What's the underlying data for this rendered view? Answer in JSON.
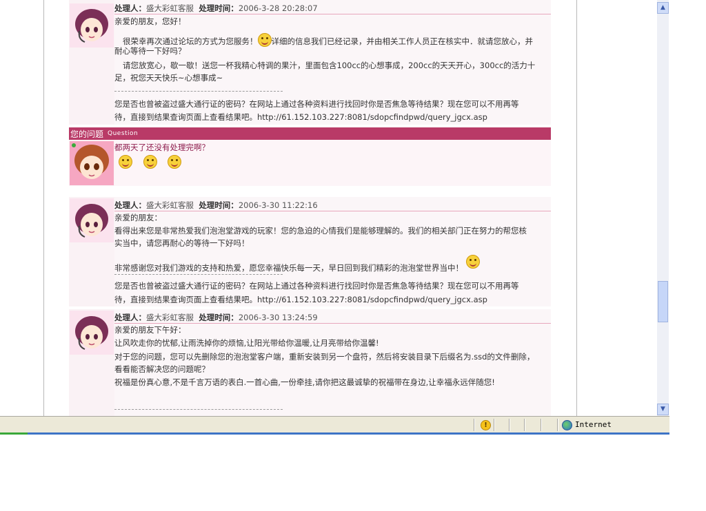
{
  "blocks": [
    {
      "header": {
        "handler_label": "处理人：",
        "handler": "盛大彩虹客服",
        "time_label": "处理时间：",
        "time": "2006-3-28 20:28:07"
      },
      "lines": [
        "亲爱的朋友，您好！",
        "很荣幸再次通过论坛的方式为您服务！",
        "详细的信息我们已经记录，并由相关工作人员正在核实中．就请您放心，并",
        "耐心等待一下好吗？",
        "请您放宽心，歇一歇！送您一杯我精心特调的果汁，里面包含100cc的心想事成，200cc的天天开心，300cc的活力十",
        "足，祝您天天快乐~心想事成~",
        "您是否也曾被盗过盛大通行证的密码？在网站上通过各种资料进行找回时你是否焦急等待结果？现在您可以不用再等",
        "待，直接到结果查询页面上查看结果吧。http://61.152.103.227:8081/sdopcfindpwd/query_jgcx.asp"
      ]
    },
    {
      "header": {
        "handler_label": "处理人：",
        "handler": "盛大彩虹客服",
        "time_label": "处理时间：",
        "time": "2006-3-30 11:22:16"
      },
      "lines": [
        "亲爱的朋友：",
        "看得出来您是非常热爱我们泡泡堂游戏的玩家！您的急迫的心情我们是能够理解的。我们的相关部门正在努力的帮您核",
        "实当中，请您再耐心的等待一下好吗！",
        "非常感谢您对我们游戏的支持和热爱，愿您幸福快乐每一天，早日回到我们精彩的泡泡堂世界当中！",
        "您是否也曾被盗过盛大通行证的密码？在网站上通过各种资料进行找回时你是否焦急等待结果？现在您可以不用再等",
        "待，直接到结果查询页面上查看结果吧。http://61.152.103.227:8081/sdopcfindpwd/query_jgcx.asp"
      ]
    },
    {
      "header": {
        "handler_label": "处理人：",
        "handler": "盛大彩虹客服",
        "time_label": "处理时间：",
        "time": "2006-3-30 13:24:59"
      },
      "lines": [
        "亲爱的朋友下午好：",
        "让风吹走你的忧郁,让雨洗掉你的烦恼,让阳光带给你温暖,让月亮带给你温馨!",
        "对于您的问题，您可以先删除您的泡泡堂客户端，重新安装到另一个盘符，然后将安装目录下后缀名为.ssd的文件删除，",
        "看看能否解决您的问题呢？",
        "祝福是份真心意,不是千言万语的表白.一首心曲,一份牵挂,请你把这最诚挚的祝福带在身边,让幸福永远伴随您!"
      ]
    }
  ],
  "question": {
    "title": "您的问题",
    "subtitle": "Question",
    "text": "都两天了还没有处理完啊？"
  },
  "statusbar": {
    "zone": "Internet",
    "warn": "!"
  },
  "scrollbar": {
    "up": "▲",
    "down": "▼"
  },
  "colors": {
    "question_bar": "#b93a67",
    "divider": "#e7a6bc",
    "block_bg": "#faf2f5"
  }
}
